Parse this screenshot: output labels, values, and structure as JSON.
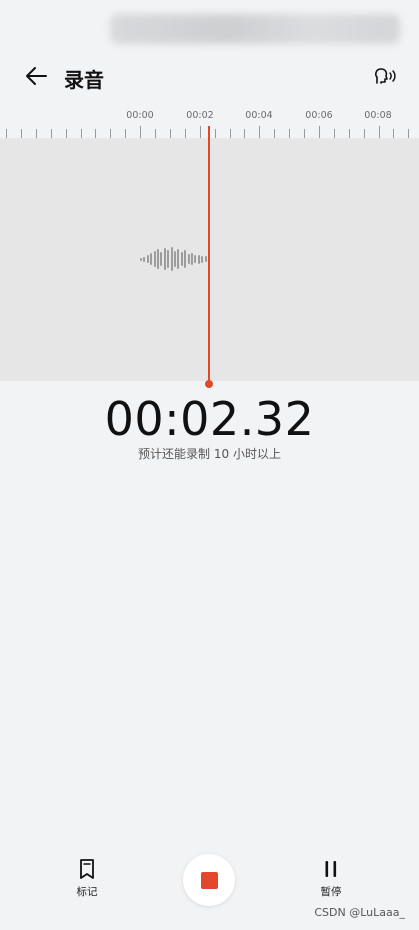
{
  "header": {
    "title": "录音",
    "back_icon": "arrow-left-icon",
    "voice_icon": "voice-person-icon"
  },
  "ruler": {
    "labels": [
      "00:00",
      "00:02",
      "00:04",
      "00:06",
      "00:08"
    ]
  },
  "recorder": {
    "elapsed": "00:02.32",
    "remaining": "预计还能录制 10 小时以上"
  },
  "controls": {
    "mark_label": "标记",
    "pause_label": "暂停",
    "stop_icon": "stop-icon",
    "mark_icon": "bookmark-icon",
    "pause_icon": "pause-icon"
  },
  "watermark": "CSDN @LuLaaa_",
  "colors": {
    "accent": "#e2472c",
    "background": "#f2f3f5",
    "wave_area": "#e6e6e7"
  }
}
